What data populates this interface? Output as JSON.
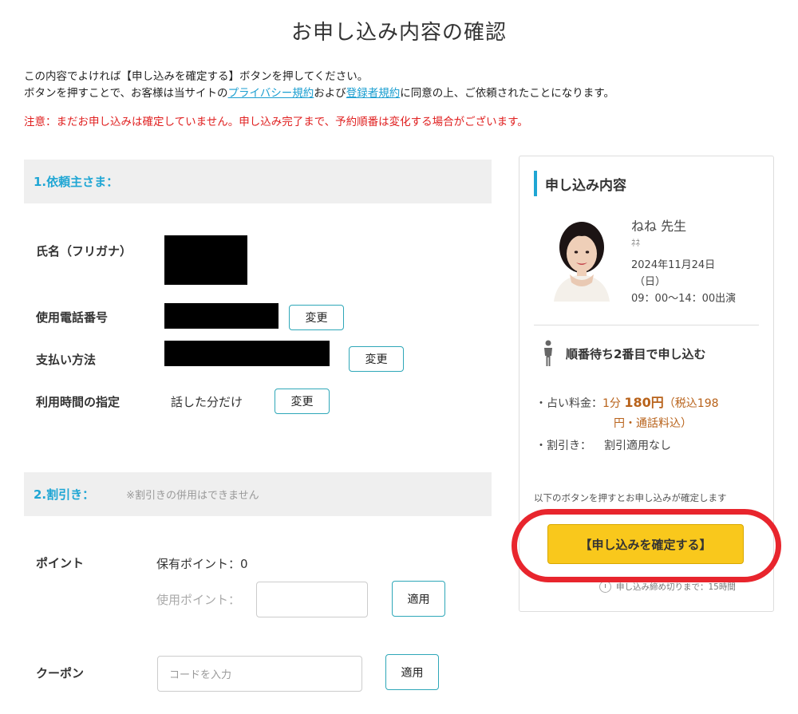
{
  "title": "お申し込み内容の確認",
  "intro": {
    "line1": "この内容でよければ【申し込みを確定する】ボタンを押してください。",
    "line2_a": "ボタンを押すことで、お客様は当サイトの",
    "privacy_link": "プライバシー規約",
    "line2_b": "および",
    "terms_link": "登録者規約",
    "line2_c": "に同意の上、ご依頼されたことになります。"
  },
  "warning": "注意：まだお申し込みは確定していません。申し込み完了まで、予約順番は変化する場合がございます。",
  "section1": {
    "heading": "1.依頼主さま：",
    "name_label": "氏名（フリガナ）",
    "phone_label": "使用電話番号",
    "payment_label": "支払い方法",
    "time_label": "利用時間の指定",
    "time_value": "話した分だけ",
    "change_label": "変更"
  },
  "section2": {
    "heading": "2.割引き：",
    "note": "※割引きの併用はできません",
    "point_label": "ポイント",
    "held_points": "保有ポイント：0",
    "use_points_label": "使用ポイント：",
    "apply_label": "適用",
    "coupon_label": "クーポン",
    "coupon_placeholder": "コードを入力"
  },
  "summary": {
    "title": "申し込み内容",
    "fortune_teller": "ねね 先生",
    "kana": "ﾈﾈ",
    "date_line1": "2024年11月24日",
    "date_line2": "（日）",
    "time_line": "09：00～14：00出演",
    "queue": "順番待ち2番目で申し込む",
    "fee_label": "・占い料金：",
    "fee_prefix": "1分",
    "fee_amount": "180円",
    "fee_tax_a": "（税込198",
    "fee_tax_b": "円・通話料込）",
    "discount_label": "・割引き：",
    "discount_value": "割引適用なし",
    "confirm_note": "以下のボタンを押すとお申し込みが確定します",
    "confirm_button": "【申し込みを確定する】",
    "deadline": "申し込み締め切りまで：15時間"
  },
  "colors": {
    "accent": "#1fa6d4",
    "warning": "#e02020",
    "fee": "#b8621a",
    "confirm": "#f9c81c",
    "highlight_ring": "#e8252d"
  }
}
